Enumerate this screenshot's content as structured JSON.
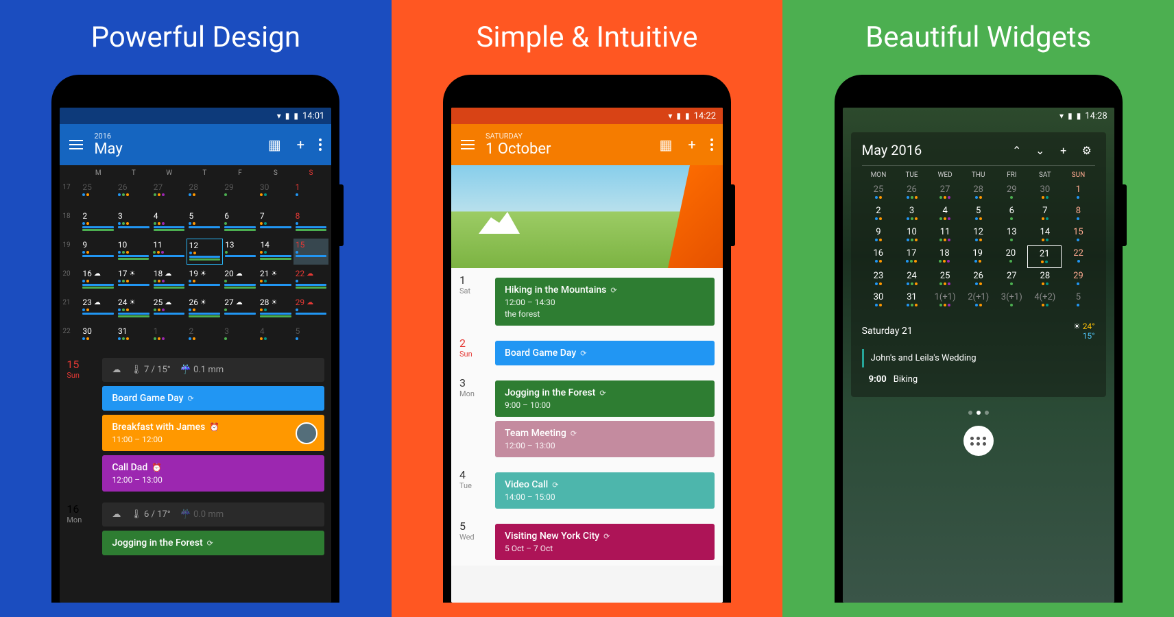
{
  "panels": {
    "blue": {
      "headline": "Powerful Design"
    },
    "orange": {
      "headline": "Simple & Intuitive"
    },
    "green": {
      "headline": "Beautiful Widgets"
    }
  },
  "screen1": {
    "status_time": "14:01",
    "year": "2016",
    "month": "May",
    "dow": [
      "M",
      "T",
      "W",
      "T",
      "F",
      "S",
      "S"
    ],
    "weeks": [
      "17",
      "18",
      "19",
      "20",
      "21",
      "22"
    ],
    "grid": [
      [
        "25",
        "26",
        "27",
        "28",
        "29",
        "30",
        "1"
      ],
      [
        "2",
        "3",
        "4",
        "5",
        "6",
        "7",
        "8"
      ],
      [
        "9",
        "10",
        "11",
        "12",
        "13",
        "14",
        "15"
      ],
      [
        "16",
        "17",
        "18",
        "19",
        "20",
        "21",
        "22"
      ],
      [
        "23",
        "24",
        "25",
        "26",
        "27",
        "28",
        "29"
      ],
      [
        "30",
        "31",
        "1",
        "2",
        "3",
        "4",
        "5"
      ]
    ],
    "agenda": [
      {
        "d": "15",
        "day": "Sun",
        "red": true,
        "weather": {
          "temp": "7 / 15°",
          "precip": "0.1 mm"
        },
        "events": [
          {
            "c": "blue",
            "t": "Board Game Day",
            "sync": true
          },
          {
            "c": "orange",
            "t": "Breakfast with James",
            "s": "11:00 – 12:00",
            "alarm": true,
            "avatar": true
          },
          {
            "c": "purple",
            "t": "Call Dad",
            "s": "12:00 – 13:00",
            "alarm": true
          }
        ]
      },
      {
        "d": "16",
        "day": "Mon",
        "weather": {
          "temp": "6 / 17°",
          "precip": "0.0 mm",
          "dim": true
        },
        "events": [
          {
            "c": "green",
            "t": "Jogging in the Forest",
            "sync": true
          }
        ]
      }
    ]
  },
  "screen2": {
    "status_time": "14:22",
    "day_label": "SATURDAY",
    "date_label": "1 October",
    "list": [
      {
        "d": "1",
        "day": "Sat",
        "events": [
          {
            "c": "green",
            "t": "Hiking in the Mountains",
            "s": "12:00 – 14:30",
            "loc": "the forest",
            "sync": true
          }
        ]
      },
      {
        "d": "2",
        "day": "Sun",
        "red": true,
        "events": [
          {
            "c": "blue",
            "t": "Board Game Day",
            "sync": true
          }
        ]
      },
      {
        "d": "3",
        "day": "Mon",
        "events": [
          {
            "c": "green",
            "t": "Jogging in the Forest",
            "s": "9:00 – 10:00",
            "sync": true
          },
          {
            "c": "pink",
            "t": "Team Meeting",
            "s": "12:00 – 13:00",
            "sync": true
          }
        ]
      },
      {
        "d": "4",
        "day": "Tue",
        "events": [
          {
            "c": "teal",
            "t": "Video Call",
            "s": "14:00 – 15:00",
            "sync": true
          }
        ]
      },
      {
        "d": "5",
        "day": "Wed",
        "events": [
          {
            "c": "magenta",
            "t": "Visiting New York City",
            "s": "5 Oct – 7 Oct",
            "sync": true
          }
        ]
      }
    ]
  },
  "screen3": {
    "status_time": "14:28",
    "title": "May 2016",
    "dow": [
      "MON",
      "TUE",
      "WED",
      "THU",
      "FRI",
      "SAT",
      "SUN"
    ],
    "grid": [
      [
        "25",
        "26",
        "27",
        "28",
        "29",
        "30",
        "1"
      ],
      [
        "2",
        "3",
        "4",
        "5",
        "6",
        "7",
        "8"
      ],
      [
        "9",
        "10",
        "11",
        "12",
        "13",
        "14",
        "15"
      ],
      [
        "16",
        "17",
        "18",
        "19",
        "20",
        "21",
        "22"
      ],
      [
        "23",
        "24",
        "25",
        "26",
        "27",
        "28",
        "29"
      ],
      [
        "30",
        "31",
        "1(+1)",
        "2(+1)",
        "3(+1)",
        "4(+2)",
        "5"
      ]
    ],
    "agenda_day": "Saturday 21",
    "temp_hi": "24°",
    "temp_lo": "15°",
    "ev1": "John's and Leila's Wedding",
    "ev2_time": "9:00",
    "ev2_title": "Biking"
  }
}
